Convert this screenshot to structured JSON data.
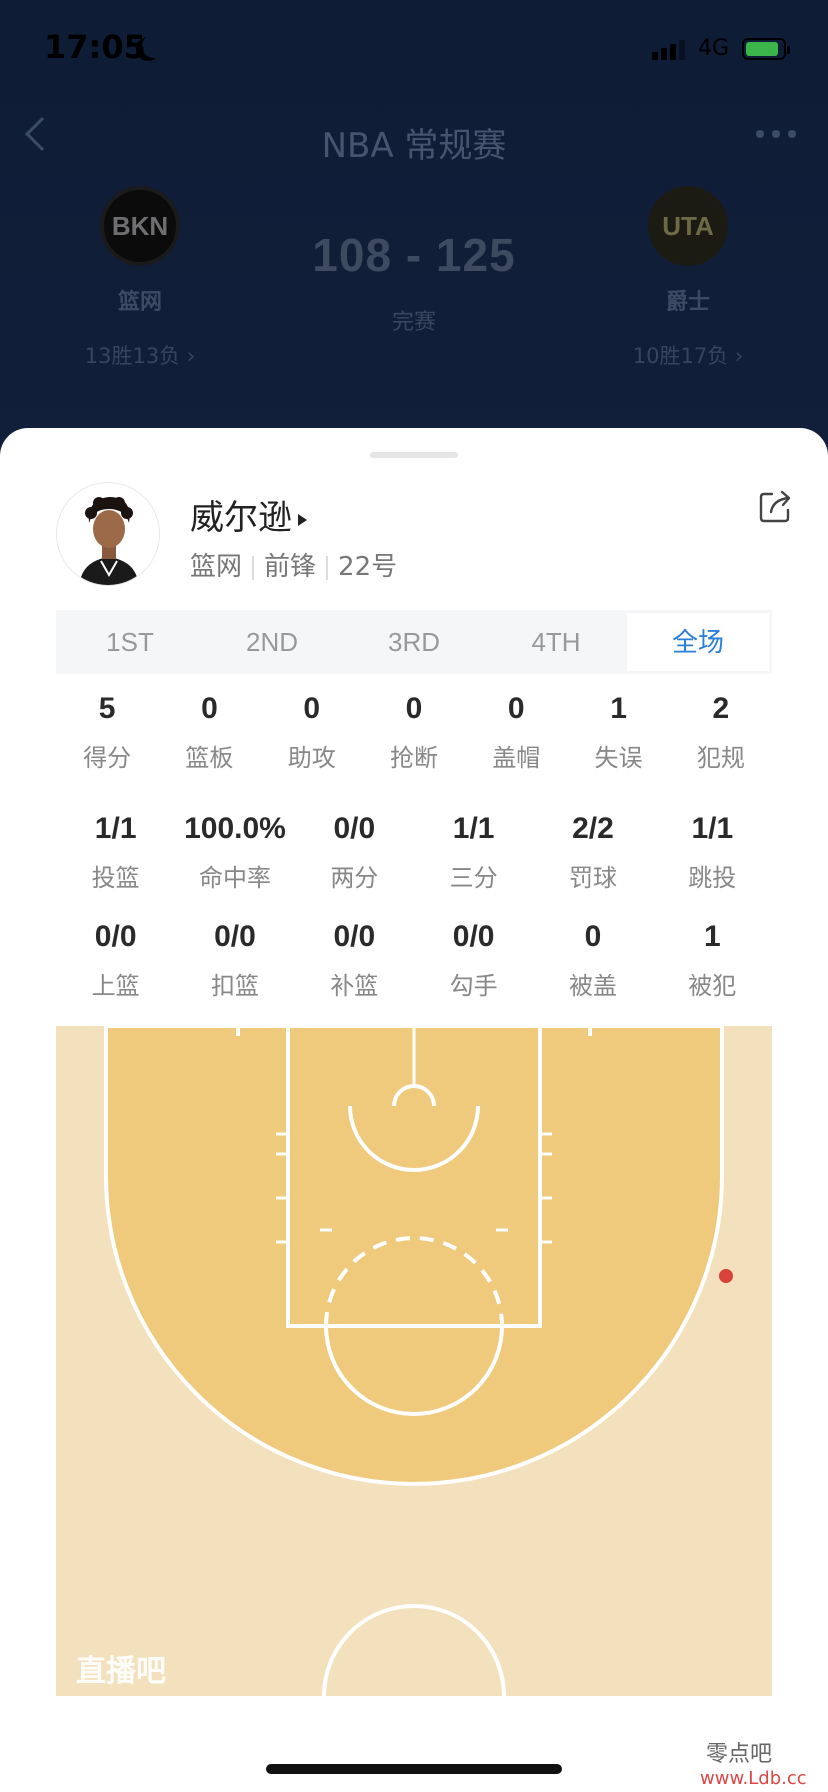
{
  "status_bar": {
    "time": "17:05",
    "network": "4G"
  },
  "header": {
    "title": "NBA 常规赛",
    "score": "108 - 125",
    "game_status": "完赛"
  },
  "home_team": {
    "logo_text": "BKN",
    "name": "篮网",
    "record": "13胜13负 ›"
  },
  "away_team": {
    "logo_text": "UTA",
    "name": "爵士",
    "record": "10胜17负 ›"
  },
  "player": {
    "name": "威尔逊",
    "team": "篮网",
    "position": "前锋",
    "number": "22号"
  },
  "tabs": [
    "1ST",
    "2ND",
    "3RD",
    "4TH",
    "全场"
  ],
  "active_tab": "全场",
  "stats_main": [
    {
      "value": "5",
      "label": "得分"
    },
    {
      "value": "0",
      "label": "篮板"
    },
    {
      "value": "0",
      "label": "助攻"
    },
    {
      "value": "0",
      "label": "抢断"
    },
    {
      "value": "0",
      "label": "盖帽"
    },
    {
      "value": "1",
      "label": "失误"
    },
    {
      "value": "2",
      "label": "犯规"
    }
  ],
  "stats_shooting": [
    {
      "value": "1/1",
      "label": "投篮"
    },
    {
      "value": "100.0%",
      "label": "命中率"
    },
    {
      "value": "0/0",
      "label": "两分"
    },
    {
      "value": "1/1",
      "label": "三分"
    },
    {
      "value": "2/2",
      "label": "罚球"
    },
    {
      "value": "1/1",
      "label": "跳投"
    }
  ],
  "stats_shot_types": [
    {
      "value": "0/0",
      "label": "上篮"
    },
    {
      "value": "0/0",
      "label": "扣篮"
    },
    {
      "value": "0/0",
      "label": "补篮"
    },
    {
      "value": "0/0",
      "label": "勾手"
    },
    {
      "value": "0",
      "label": "被盖"
    },
    {
      "value": "1",
      "label": "被犯"
    }
  ],
  "court": {
    "watermark": "直播吧",
    "made_shot_color": "#d9423a"
  },
  "site": {
    "mark": "零点吧",
    "url": "www.Ldb.cc"
  },
  "colors": {
    "accent": "#2b7fd6",
    "court_paint": "#efc97c",
    "court_floor": "#f3e1bd"
  }
}
